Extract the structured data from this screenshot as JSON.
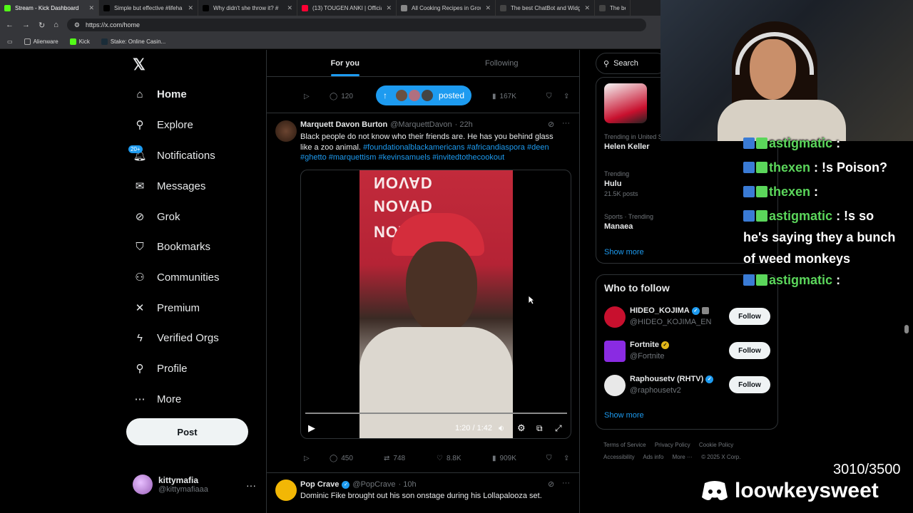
{
  "browser": {
    "tabs": [
      {
        "title": "Stream - Kick Dashboard",
        "color": "#53fc18"
      },
      {
        "title": "Simple but effective #lifeha",
        "color": "#000000"
      },
      {
        "title": "Why didn't she throw it? #",
        "color": "#000000"
      },
      {
        "title": "(13) TOUGEN ANKI | Officia",
        "color": "#ff0033"
      },
      {
        "title": "All Cooking Recipes in Grow",
        "color": "#888888"
      },
      {
        "title": "The best ChatBot and Widg",
        "color": "#444444"
      },
      {
        "title": "The best Cha",
        "color": "#444444"
      }
    ],
    "url": "https://x.com/home",
    "bookmarks": [
      "Alienware",
      "Kick",
      "Stake: Online Casin..."
    ]
  },
  "nav": {
    "items": [
      "Home",
      "Explore",
      "Notifications",
      "Messages",
      "Grok",
      "Bookmarks",
      "Communities",
      "Premium",
      "Verified Orgs",
      "Profile",
      "More"
    ],
    "notif_badge": "20+",
    "post_label": "Post",
    "user_name": "kittymafia",
    "user_handle": "@kittymafiaaa"
  },
  "feed": {
    "tabs": [
      "For you",
      "Following"
    ],
    "posted_label": "posted",
    "prev_stats": {
      "views_small": "120",
      "views": "167K"
    },
    "tweet1": {
      "name": "Marquett Davon Burton",
      "handle": "@MarquettDavon",
      "time": "· 22h",
      "text": "Black people do not know who their friends are. He has you behind glass like a zoo animal.",
      "tags": "#foundationalblackamericans #africandiaspora #deen #ghetto #marquettism #kevinsamuels #invitedtothecookout",
      "video_time": "1:20 / 1:42",
      "stats": {
        "replies": "450",
        "reposts": "748",
        "likes": "8.8K",
        "views": "909K"
      }
    },
    "tweet2": {
      "name": "Pop Crave",
      "handle": "@PopCrave",
      "time": "· 10h",
      "text": "Dominic Fike brought out his son onstage during his Lollapalooza set."
    }
  },
  "right": {
    "search_placeholder": "Search",
    "trends": [
      {
        "context": "Trending in United States",
        "title": "Helen Keller",
        "count": ""
      },
      {
        "context": "Trending",
        "title": "Hulu",
        "count": "21.5K posts"
      },
      {
        "context": "Sports · Trending",
        "title": "Manaea",
        "count": ""
      }
    ],
    "show_more": "Show more",
    "who_to_follow_title": "Who to follow",
    "who_to_follow": [
      {
        "name": "HIDEO_KOJIMA",
        "handle": "@HIDEO_KOJIMA_EN",
        "color": "#c8102e",
        "badge": "blue"
      },
      {
        "name": "Fortnite",
        "handle": "@Fortnite",
        "color": "#8a2be2",
        "badge": "gold"
      },
      {
        "name": "Raphousetv (RHTV)",
        "handle": "@raphousetv2",
        "color": "#e8e8e8",
        "badge": "blue"
      }
    ],
    "follow_label": "Follow",
    "footer": [
      "Terms of Service",
      "Privacy Policy",
      "Cookie Policy",
      "Accessibility",
      "Ads info",
      "More ···",
      "© 2025 X Corp."
    ]
  },
  "stream": {
    "chat": [
      {
        "user": "astigmatic",
        "msg": ":"
      },
      {
        "user": "thexen",
        "msg": ": !s Poison?"
      },
      {
        "user": "thexen",
        "msg": ":"
      },
      {
        "user": "astigmatic",
        "msg": ": !s so"
      },
      {
        "user": "",
        "msg": "he's saying they a bunch"
      },
      {
        "user": "",
        "msg": "of weed monkeys"
      },
      {
        "user": "astigmatic",
        "msg": ":"
      }
    ],
    "counter": "3010/3500",
    "discord_name": "loowkeysweet"
  }
}
